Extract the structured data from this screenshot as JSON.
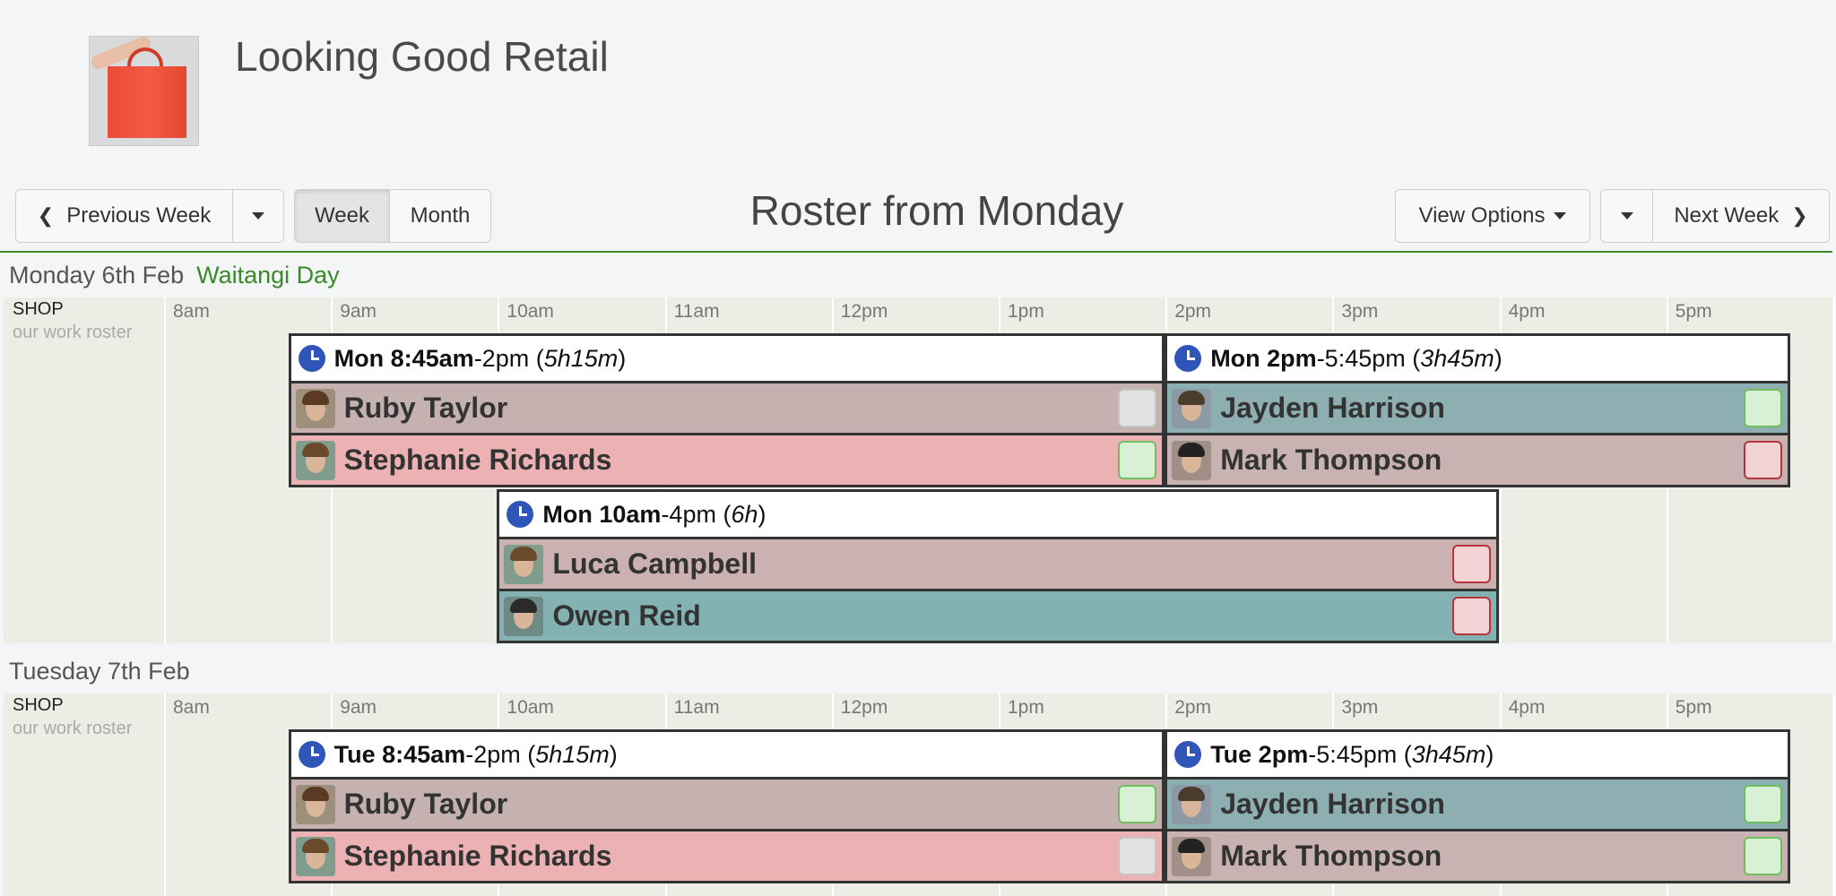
{
  "header": {
    "company_name": "Looking Good Retail"
  },
  "toolbar": {
    "previous_week_label": "Previous Week",
    "week_label": "Week",
    "month_label": "Month",
    "roster_title": "Roster from Monday",
    "view_options_label": "View Options",
    "next_week_label": "Next Week",
    "active_view": "Week"
  },
  "hours": [
    "8am",
    "9am",
    "10am",
    "11am",
    "12pm",
    "1pm",
    "2pm",
    "3pm",
    "4pm",
    "5pm"
  ],
  "days": [
    {
      "date": "Monday 6th Feb",
      "holiday": "Waitangi Day",
      "location": "SHOP",
      "location_sub": "our work roster",
      "shifts": [
        {
          "day": "Mon",
          "start": "8:45am",
          "end": "2pm",
          "duration": "5h15m",
          "staff": [
            {
              "name": "Ruby Taylor",
              "status": "grey",
              "color": "#c4b1b0"
            },
            {
              "name": "Stephanie Richards",
              "status": "green",
              "color": "#ecb1b2"
            }
          ]
        },
        {
          "day": "Mon",
          "start": "2pm",
          "end": "5:45pm",
          "duration": "3h45m",
          "staff": [
            {
              "name": "Jayden Harrison",
              "status": "green",
              "color": "#8eafb1"
            },
            {
              "name": "Mark Thompson",
              "status": "red",
              "color": "#c9b2b2"
            }
          ]
        },
        {
          "day": "Mon",
          "start": "10am",
          "end": "4pm",
          "duration": "6h",
          "staff": [
            {
              "name": "Luca Campbell",
              "status": "red",
              "color": "#cbb1b1"
            },
            {
              "name": "Owen Reid",
              "status": "red",
              "color": "#84b1b2"
            }
          ]
        }
      ]
    },
    {
      "date": "Tuesday 7th Feb",
      "holiday": "",
      "location": "SHOP",
      "location_sub": "our work roster",
      "shifts": [
        {
          "day": "Tue",
          "start": "8:45am",
          "end": "2pm",
          "duration": "5h15m",
          "staff": [
            {
              "name": "Ruby Taylor",
              "status": "green",
              "color": "#c4b1b0"
            },
            {
              "name": "Stephanie Richards",
              "status": "grey",
              "color": "#ecb1b2"
            }
          ]
        },
        {
          "day": "Tue",
          "start": "2pm",
          "end": "5:45pm",
          "duration": "3h45m",
          "staff": [
            {
              "name": "Jayden Harrison",
              "status": "green",
              "color": "#8eafb1"
            },
            {
              "name": "Mark Thompson",
              "status": "green",
              "color": "#c9b2b2"
            }
          ]
        }
      ]
    }
  ]
}
